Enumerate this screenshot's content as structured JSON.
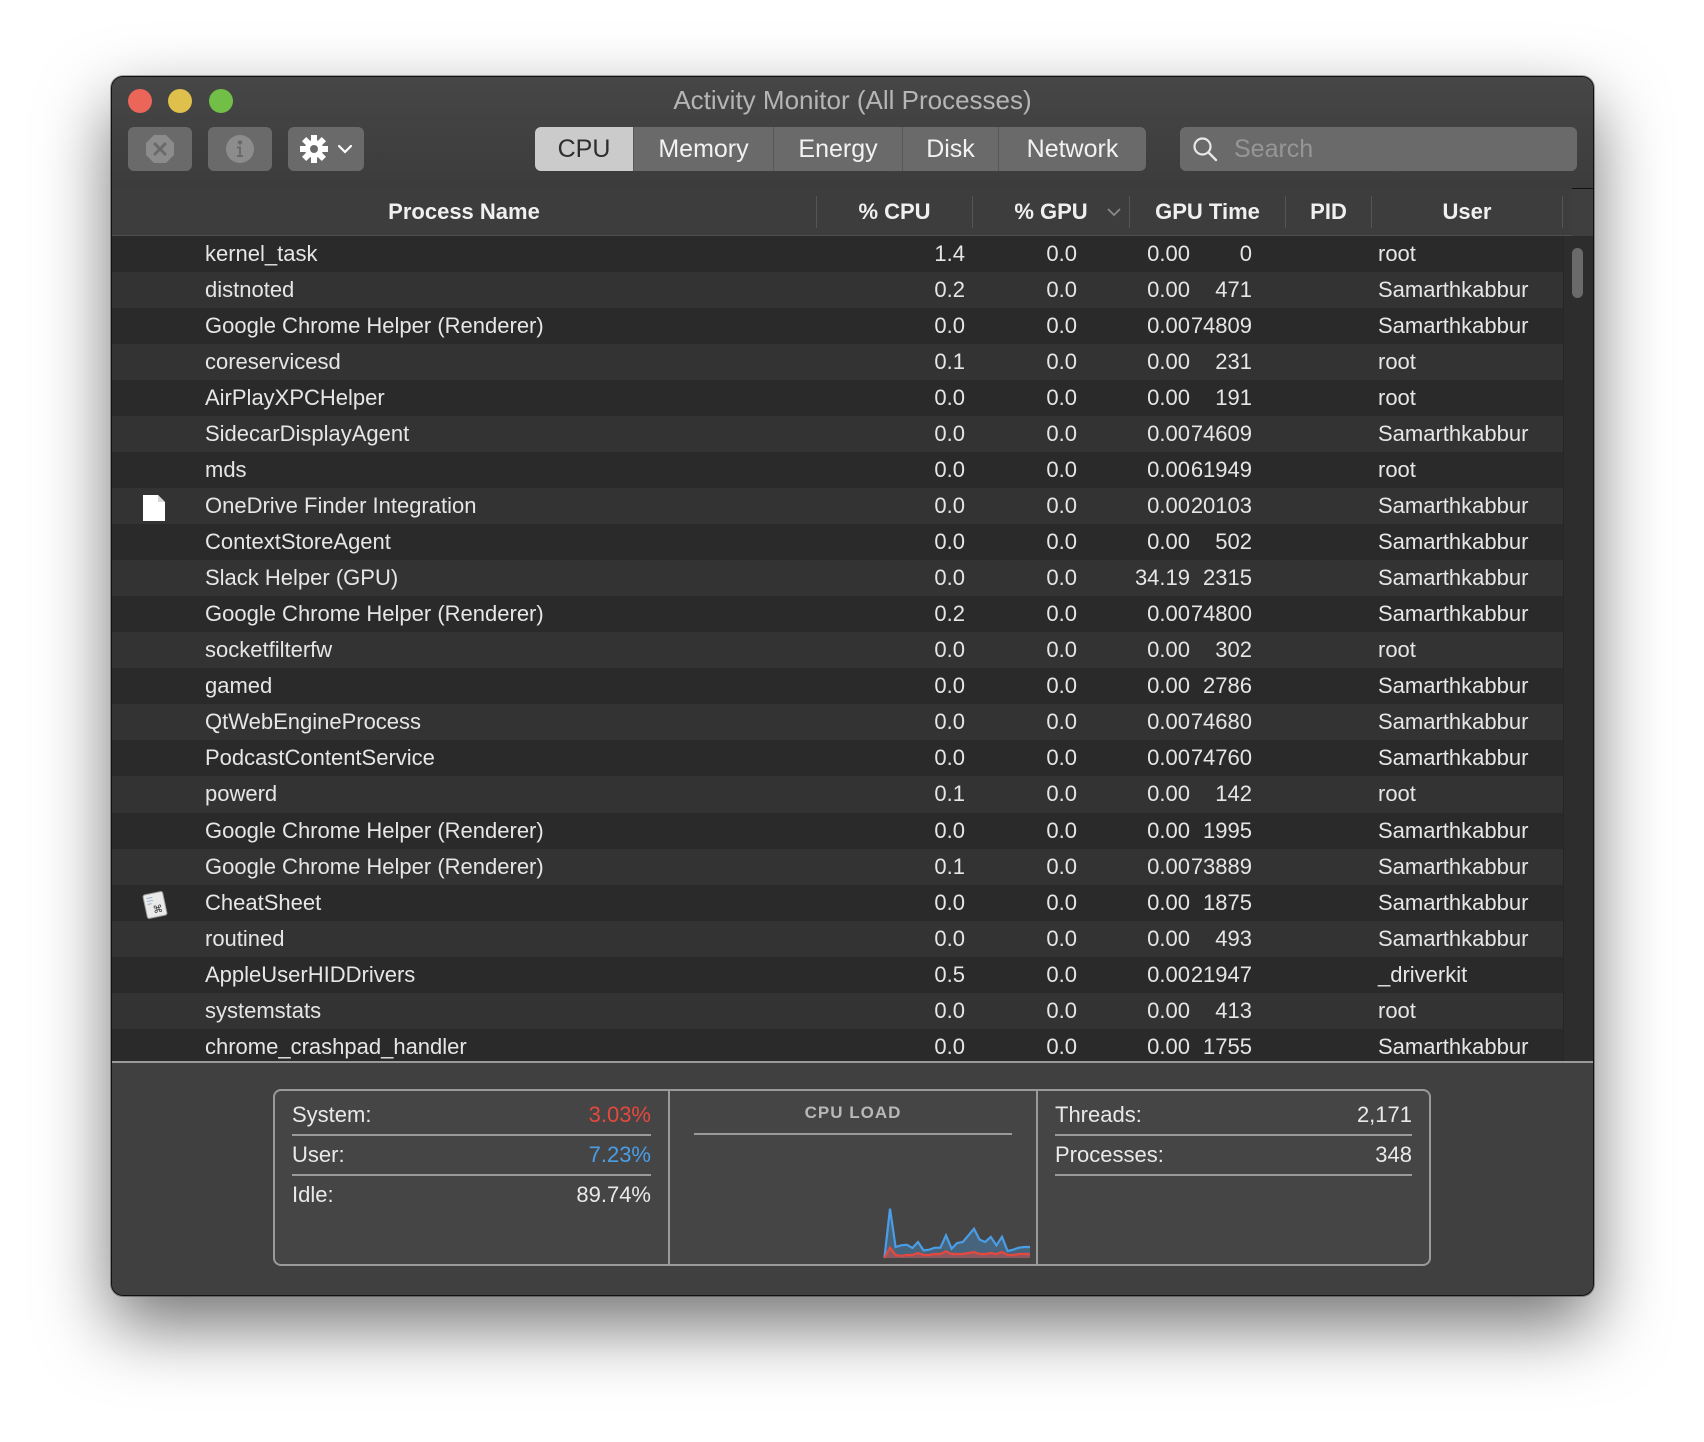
{
  "window": {
    "title": "Activity Monitor (All Processes)"
  },
  "toolbar": {
    "stop_button": "stop-process",
    "info_button": "inspect-process",
    "gear_button": "view-options",
    "tabs": [
      {
        "label": "CPU",
        "active": true
      },
      {
        "label": "Memory",
        "active": false
      },
      {
        "label": "Energy",
        "active": false
      },
      {
        "label": "Disk",
        "active": false
      },
      {
        "label": "Network",
        "active": false
      }
    ],
    "search_placeholder": "Search",
    "search_value": ""
  },
  "table": {
    "columns": [
      "Process Name",
      "% CPU",
      "% GPU",
      "GPU Time",
      "PID",
      "User"
    ],
    "sorted_column": "% GPU",
    "sort_direction": "descending",
    "rows": [
      {
        "name": "kernel_task",
        "icon": "",
        "cpu": "1.4",
        "gpu": "0.0",
        "gpu_time": "0.00",
        "pid": "0",
        "user": "root"
      },
      {
        "name": "distnoted",
        "icon": "",
        "cpu": "0.2",
        "gpu": "0.0",
        "gpu_time": "0.00",
        "pid": "471",
        "user": "Samarthkabbur"
      },
      {
        "name": "Google Chrome Helper (Renderer)",
        "icon": "",
        "cpu": "0.0",
        "gpu": "0.0",
        "gpu_time": "0.00",
        "pid": "74809",
        "user": "Samarthkabbur"
      },
      {
        "name": "coreservicesd",
        "icon": "",
        "cpu": "0.1",
        "gpu": "0.0",
        "gpu_time": "0.00",
        "pid": "231",
        "user": "root"
      },
      {
        "name": "AirPlayXPCHelper",
        "icon": "",
        "cpu": "0.0",
        "gpu": "0.0",
        "gpu_time": "0.00",
        "pid": "191",
        "user": "root"
      },
      {
        "name": "SidecarDisplayAgent",
        "icon": "",
        "cpu": "0.0",
        "gpu": "0.0",
        "gpu_time": "0.00",
        "pid": "74609",
        "user": "Samarthkabbur"
      },
      {
        "name": "mds",
        "icon": "",
        "cpu": "0.0",
        "gpu": "0.0",
        "gpu_time": "0.00",
        "pid": "61949",
        "user": "root"
      },
      {
        "name": "OneDrive Finder Integration",
        "icon": "document-icon",
        "cpu": "0.0",
        "gpu": "0.0",
        "gpu_time": "0.00",
        "pid": "20103",
        "user": "Samarthkabbur"
      },
      {
        "name": "ContextStoreAgent",
        "icon": "",
        "cpu": "0.0",
        "gpu": "0.0",
        "gpu_time": "0.00",
        "pid": "502",
        "user": "Samarthkabbur"
      },
      {
        "name": "Slack Helper (GPU)",
        "icon": "",
        "cpu": "0.0",
        "gpu": "0.0",
        "gpu_time": "34.19",
        "pid": "2315",
        "user": "Samarthkabbur"
      },
      {
        "name": "Google Chrome Helper (Renderer)",
        "icon": "",
        "cpu": "0.2",
        "gpu": "0.0",
        "gpu_time": "0.00",
        "pid": "74800",
        "user": "Samarthkabbur"
      },
      {
        "name": "socketfilterfw",
        "icon": "",
        "cpu": "0.0",
        "gpu": "0.0",
        "gpu_time": "0.00",
        "pid": "302",
        "user": "root"
      },
      {
        "name": "gamed",
        "icon": "",
        "cpu": "0.0",
        "gpu": "0.0",
        "gpu_time": "0.00",
        "pid": "2786",
        "user": "Samarthkabbur"
      },
      {
        "name": "QtWebEngineProcess",
        "icon": "",
        "cpu": "0.0",
        "gpu": "0.0",
        "gpu_time": "0.00",
        "pid": "74680",
        "user": "Samarthkabbur"
      },
      {
        "name": "PodcastContentService",
        "icon": "",
        "cpu": "0.0",
        "gpu": "0.0",
        "gpu_time": "0.00",
        "pid": "74760",
        "user": "Samarthkabbur"
      },
      {
        "name": "powerd",
        "icon": "",
        "cpu": "0.1",
        "gpu": "0.0",
        "gpu_time": "0.00",
        "pid": "142",
        "user": "root"
      },
      {
        "name": "Google Chrome Helper (Renderer)",
        "icon": "",
        "cpu": "0.0",
        "gpu": "0.0",
        "gpu_time": "0.00",
        "pid": "1995",
        "user": "Samarthkabbur"
      },
      {
        "name": "Google Chrome Helper (Renderer)",
        "icon": "",
        "cpu": "0.1",
        "gpu": "0.0",
        "gpu_time": "0.00",
        "pid": "73889",
        "user": "Samarthkabbur"
      },
      {
        "name": "CheatSheet",
        "icon": "cheatsheet-app-icon",
        "cpu": "0.0",
        "gpu": "0.0",
        "gpu_time": "0.00",
        "pid": "1875",
        "user": "Samarthkabbur"
      },
      {
        "name": "routined",
        "icon": "",
        "cpu": "0.0",
        "gpu": "0.0",
        "gpu_time": "0.00",
        "pid": "493",
        "user": "Samarthkabbur"
      },
      {
        "name": "AppleUserHIDDrivers",
        "icon": "",
        "cpu": "0.5",
        "gpu": "0.0",
        "gpu_time": "0.00",
        "pid": "21947",
        "user": "_driverkit"
      },
      {
        "name": "systemstats",
        "icon": "",
        "cpu": "0.0",
        "gpu": "0.0",
        "gpu_time": "0.00",
        "pid": "413",
        "user": "root"
      },
      {
        "name": "chrome_crashpad_handler",
        "icon": "",
        "cpu": "0.0",
        "gpu": "0.0",
        "gpu_time": "0.00",
        "pid": "1755",
        "user": "Samarthkabbur"
      }
    ]
  },
  "summary": {
    "system_label": "System:",
    "system_value": "3.03%",
    "user_label": "User:",
    "user_value": "7.23%",
    "idle_label": "Idle:",
    "idle_value": "89.74%",
    "cpu_load_title": "CPU LOAD",
    "threads_label": "Threads:",
    "threads_value": "2,171",
    "processes_label": "Processes:",
    "processes_value": "348",
    "colors": {
      "system": "#e5493d",
      "user": "#4b9de6",
      "label": "#e9e9e9"
    }
  },
  "chart_data": {
    "type": "area",
    "title": "CPU LOAD",
    "ylim": [
      0,
      100
    ],
    "series": [
      {
        "name": "User+System",
        "color": "#4b9de6",
        "values": [
          0,
          40.8,
          9.1,
          10.5,
          11.0,
          8.3,
          13.2,
          6.3,
          6.9,
          8.5,
          8.5,
          18.7,
          7.7,
          12.4,
          13.2,
          18.7,
          24.2,
          15.2,
          13.2,
          17.4,
          10.5,
          17.4,
          5.8,
          6.9,
          8.5,
          9.1,
          9.1
        ]
      },
      {
        "name": "System",
        "color": "#e5493d",
        "values": [
          0,
          8.5,
          2.5,
          1.7,
          2.5,
          2.5,
          4.1,
          2.5,
          2.5,
          3.3,
          3.3,
          5.5,
          3.3,
          3.3,
          3.3,
          4.1,
          5.0,
          3.3,
          3.3,
          4.1,
          3.3,
          5.0,
          2.5,
          2.5,
          3.3,
          3.3,
          3.3
        ]
      }
    ],
    "history_capacity": 100
  }
}
